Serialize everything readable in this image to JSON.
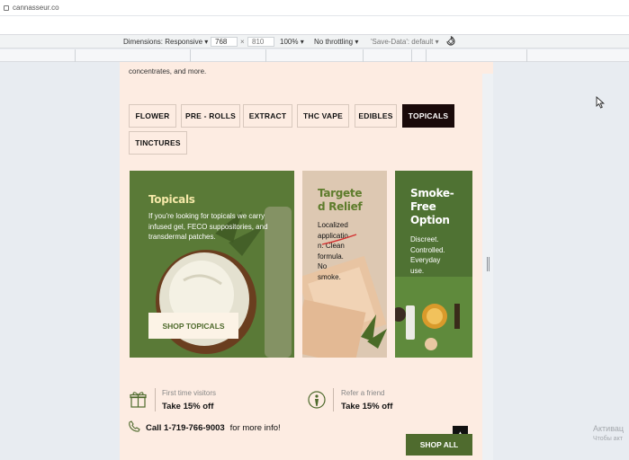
{
  "browser": {
    "url": "cannasseur.co"
  },
  "devtools": {
    "dimensions_label": "Dimensions: Responsive",
    "width_value": "768",
    "times": "×",
    "height_placeholder": "810",
    "zoom": "100%",
    "throttling": "No throttling",
    "save_data": "'Save-Data': default"
  },
  "page": {
    "cut_text": "concentrates, and more.",
    "categories": [
      {
        "label": "FLOWER",
        "active": false
      },
      {
        "label": "PRE - ROLLS",
        "active": false
      },
      {
        "label": "EXTRACT",
        "active": false
      },
      {
        "label": "THC VAPE",
        "active": false
      },
      {
        "label": "EDIBLES",
        "active": false
      },
      {
        "label": "TOPICALS",
        "active": true
      },
      {
        "label": "TINCTURES",
        "active": false
      }
    ],
    "cards": [
      {
        "title": "Topicals",
        "desc": "If you're looking for topicals we carry infused gel, FECO suppositories, and transdermal patches.",
        "button": "SHOP TOPICALS"
      },
      {
        "title_lines": [
          "Targete",
          "d Relief"
        ],
        "desc_lines": [
          "Localized",
          "applicatio",
          "n. Clean",
          "formula.",
          "No",
          "smoke."
        ]
      },
      {
        "title_lines": [
          "Smoke-",
          "Free",
          "Option"
        ],
        "desc_lines": [
          "Discreet.",
          "Controlled.",
          "Everyday",
          "use."
        ]
      }
    ],
    "promo_first": {
      "small": "First time visitors",
      "big": "Take 15% off"
    },
    "promo_refer": {
      "small": "Refer a friend",
      "big": "Take 15% off"
    },
    "call": {
      "number": "Call 1-719-766-9003",
      "suffix": "for more info!"
    },
    "shop_all": "SHOP ALL"
  },
  "os": {
    "watermark_line1": "Активац",
    "watermark_line2": "Чтобы акт"
  },
  "colors": {
    "page_bg": "#fdece2",
    "green": "#5a7a37",
    "active_tab": "#1a0a0a",
    "title_yellow": "#f5e9a8",
    "title_green": "#5e7c2c"
  }
}
